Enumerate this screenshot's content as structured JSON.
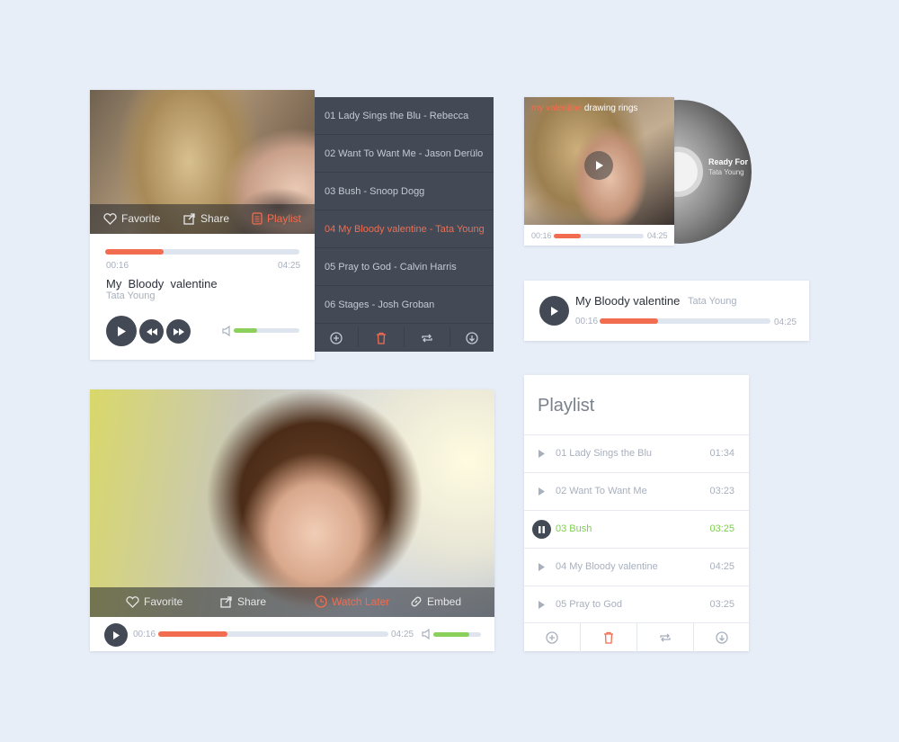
{
  "colors": {
    "accent": "#f26c4f",
    "volume": "#8bd05a",
    "dark": "#434a56",
    "background": "#e8eef8"
  },
  "player1": {
    "actions": {
      "favorite": "Favorite",
      "share": "Share",
      "playlist": "Playlist"
    },
    "time_current": "00:16",
    "time_total": "04:25",
    "progress": 0.3,
    "volume": 0.35,
    "title": "My  Bloody  valentine",
    "artist": "Tata Young"
  },
  "dark_playlist": {
    "items": [
      "01 Lady Sings the Blu - Rebecca",
      "02 Want To Want Me - Jason Derülo",
      "03 Bush - Snoop Dogg",
      "04 My Bloody valentine - Tata Young",
      "05 Pray to God - Calvin Harris",
      "06 Stages - Josh Groban"
    ],
    "active_index": 3,
    "toolbar_icons": [
      "add-icon",
      "trash-icon",
      "repeat-icon",
      "download-icon"
    ]
  },
  "album_player": {
    "caption_highlight": "my valentine",
    "caption_rest": "drawing rings",
    "disc_line1": "Ready For",
    "disc_line2": "Tata Young",
    "time_current": "00:16",
    "time_total": "04:25",
    "progress": 0.3
  },
  "mini_player": {
    "title": "My Bloody valentine",
    "artist": "Tata Young",
    "time_current": "00:16",
    "time_total": "04:25",
    "progress": 0.34
  },
  "video_player": {
    "actions": {
      "favorite": "Favorite",
      "share": "Share",
      "watch_later": "Watch Later",
      "embed": "Embed"
    },
    "time_current": "00:16",
    "time_total": "04:25",
    "progress": 0.3,
    "volume": 0.75
  },
  "light_playlist": {
    "heading": "Playlist",
    "items": [
      {
        "title": "01 Lady Sings the Blu",
        "duration": "01:34"
      },
      {
        "title": "02 Want To Want Me",
        "duration": "03:23"
      },
      {
        "title": "03 Bush",
        "duration": "03:25"
      },
      {
        "title": "04 My Bloody valentine",
        "duration": "04:25"
      },
      {
        "title": "05 Pray to God",
        "duration": "03:25"
      }
    ],
    "active_index": 2,
    "toolbar_icons": [
      "add-icon",
      "trash-icon",
      "repeat-icon",
      "download-icon"
    ]
  }
}
